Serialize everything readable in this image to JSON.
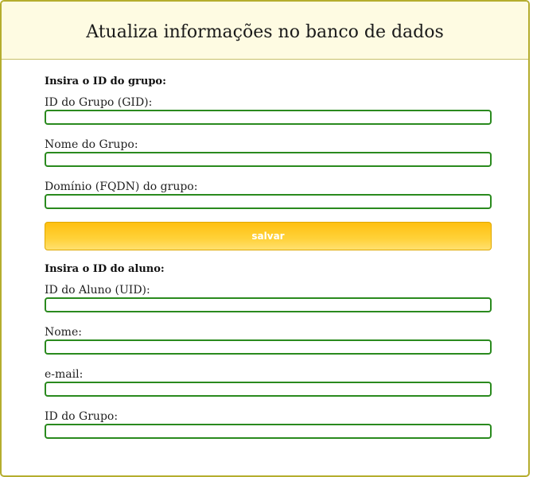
{
  "page": {
    "title": "Atualiza informações no banco de dados"
  },
  "group_section": {
    "title": "Insira o ID do grupo:",
    "fields": [
      {
        "label": "ID do Grupo (GID):",
        "value": "",
        "placeholder": ""
      },
      {
        "label": "Nome do Grupo:",
        "value": "",
        "placeholder": ""
      },
      {
        "label": "Domínio (FQDN) do grupo:",
        "value": "",
        "placeholder": ""
      }
    ],
    "save_label": "salvar"
  },
  "student_section": {
    "title": "Insira o ID do aluno:",
    "fields": [
      {
        "label": "ID do Aluno (UID):",
        "value": "",
        "placeholder": ""
      },
      {
        "label": "Nome:",
        "value": "",
        "placeholder": ""
      },
      {
        "label": "e-mail:",
        "value": "",
        "placeholder": ""
      },
      {
        "label": "ID do Grupo:",
        "value": "",
        "placeholder": ""
      }
    ]
  },
  "colors": {
    "header_background": "#fefbe2",
    "panel_border": "#b5ad2e",
    "input_border": "#2a8a1e",
    "button_gradient_top": "#ffc010",
    "button_gradient_bottom": "#ffe070",
    "button_text": "#ffffff"
  }
}
